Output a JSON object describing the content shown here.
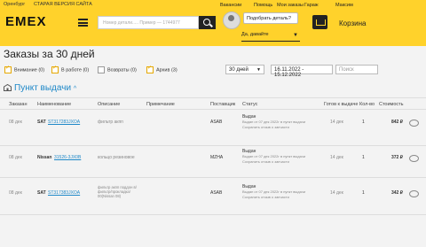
{
  "header": {
    "city": "Оренбург",
    "old_version": "СТАРАЯ ВЕРСИЯ САЙТА",
    "logo": "EMEX",
    "vacancies": "Вакансии",
    "help": "Помощь",
    "my_orders": "Мои заказы",
    "garage": "Гараж",
    "user": "Максим",
    "search_placeholder": "Номер детали..... Пример — 1744977",
    "prompt": "Подобрать деталь?",
    "prompt_yes": "Да, давайте",
    "cart": "Корзина"
  },
  "page": {
    "title": "Заказы за 30 дней",
    "filters": [
      {
        "label": "Внимание (0)",
        "checked": true
      },
      {
        "label": "В работе (0)",
        "checked": true
      },
      {
        "label": "Возвраты (0)",
        "checked": false
      },
      {
        "label": "Архив (3)",
        "checked": true
      }
    ],
    "period": "30 дней",
    "date_range": "16.11.2022 - 15.12.2022",
    "search_placeholder": "Поиск",
    "section": "Пункт выдачи"
  },
  "table": {
    "columns": [
      "Заказан",
      "Наименование",
      "Описание",
      "Примечание",
      "Поставщик",
      "Статус",
      "Готов к выдаче",
      "Кол-во",
      "Стоимость"
    ],
    "rows": [
      {
        "ordered": "08 дек",
        "brand": "SAT",
        "part": "ST317283JXOA",
        "desc": "фильтр акпп",
        "note": "",
        "supplier": "ASAB",
        "status": "Выдан",
        "status_detail": "Выдан от 07 дек 2022г в пункт выдачи",
        "status_extra": "Сохранить отзыв о запчасти",
        "ready": "14 дек",
        "qty": "1",
        "price": "842 ₽"
      },
      {
        "ordered": "08 дек",
        "brand": "Nissan",
        "part": "31526-3JX0B",
        "desc": "кольцо резиновое",
        "note": "",
        "supplier": "MZHA",
        "status": "Выдан",
        "status_detail": "Выдан от 07 дек 2022г в пункт выдачи",
        "status_extra": "Сохранить отзыв о запчасти",
        "ready": "14 дек",
        "qty": "1",
        "price": "372 ₽"
      },
      {
        "ordered": "08 дек",
        "brand": "SAT",
        "part": "ST317383JXOA",
        "desc": "фильтр акпп поддон в/фильтр/прокладка/ 00(Nissan 08)",
        "note": "",
        "supplier": "ASAB",
        "status": "Выдан",
        "status_detail": "Выдан от 07 дек 2022г в пункт выдачи",
        "status_extra": "Сохранить отзыв о запчасти",
        "ready": "14 дек",
        "qty": "1",
        "price": "342 ₽"
      }
    ]
  },
  "colors": {
    "brand_yellow": "#ffd22b",
    "link_blue": "#1e88c8"
  }
}
